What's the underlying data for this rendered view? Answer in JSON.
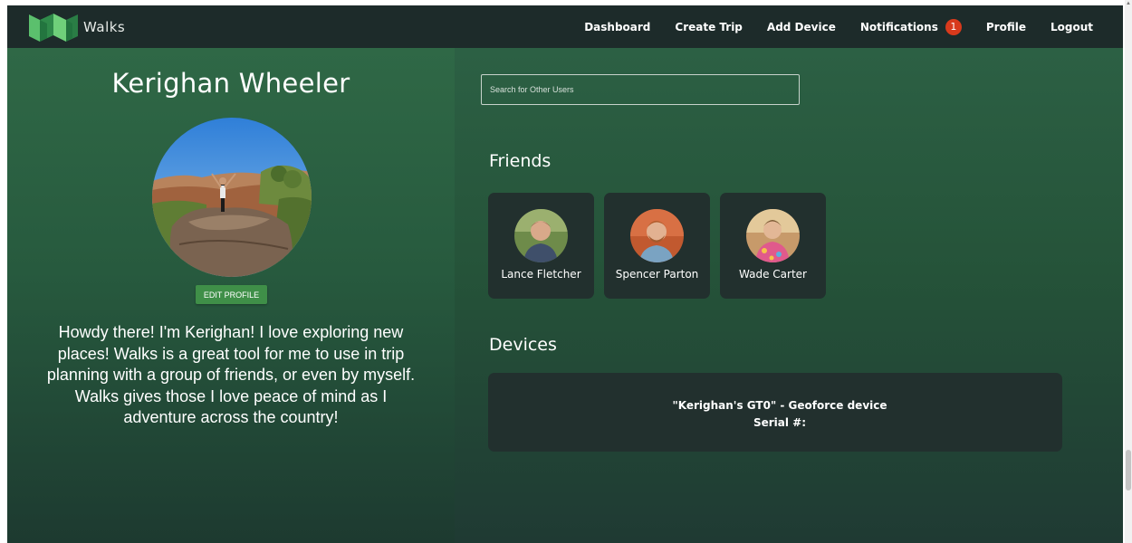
{
  "navbar": {
    "brand": "Walks",
    "links": [
      {
        "label": "Dashboard"
      },
      {
        "label": "Create Trip"
      },
      {
        "label": "Add Device"
      },
      {
        "label": "Notifications",
        "badge": "1"
      },
      {
        "label": "Profile"
      },
      {
        "label": "Logout"
      }
    ]
  },
  "profile": {
    "name": "Kerighan Wheeler",
    "edit_label": "EDIT PROFILE",
    "bio": "Howdy there! I'm Kerighan! I love exploring new places! Walks is a great tool for me to use in trip planning with a group of friends, or even by myself. Walks gives those I love peace of mind as I adventure across the country!"
  },
  "search": {
    "placeholder": "Search for Other Users",
    "value": ""
  },
  "friends": {
    "title": "Friends",
    "items": [
      {
        "name": "Lance Fletcher"
      },
      {
        "name": "Spencer Parton"
      },
      {
        "name": "Wade Carter"
      }
    ]
  },
  "devices": {
    "title": "Devices",
    "items": [
      {
        "line1": "\"Kerighan's GT0\" - Geoforce device",
        "line2": "Serial #:"
      }
    ]
  },
  "colors": {
    "navbar": "#1d2b2a",
    "accent_green": "#3f8f48",
    "card_bg": "#22302e",
    "badge_red": "#d83a1c"
  },
  "icons": {
    "logo": "walks-logo-icon"
  }
}
